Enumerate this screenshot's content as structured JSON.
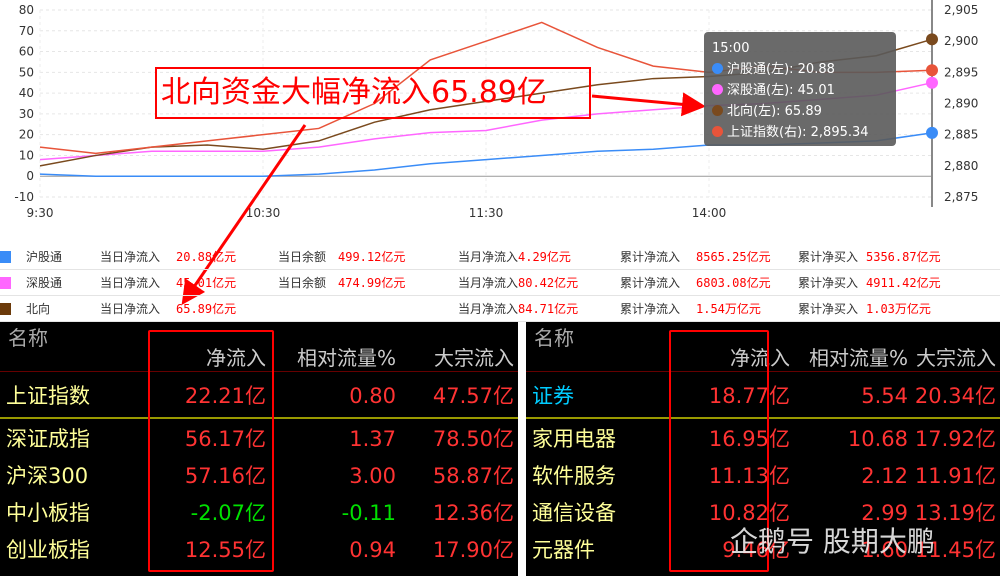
{
  "chart_data": {
    "type": "line",
    "x_ticks": [
      "9:30",
      "10:30",
      "11:30",
      "14:00"
    ],
    "y_left": {
      "range": [
        -10,
        80
      ],
      "ticks": [
        -10,
        0,
        10,
        20,
        30,
        40,
        50,
        60,
        70,
        80
      ]
    },
    "y_right": {
      "range": [
        2875,
        2905
      ],
      "ticks": [
        "2,875",
        "2,880",
        "2,885",
        "2,890",
        "2,895",
        "2,900",
        "2,905"
      ]
    },
    "times": [
      "9:30",
      "9:45",
      "10:00",
      "10:15",
      "10:30",
      "10:45",
      "11:00",
      "11:15",
      "11:30",
      "13:15",
      "13:30",
      "13:45",
      "14:00",
      "14:15",
      "14:30",
      "14:45",
      "15:00"
    ],
    "series": [
      {
        "name": "沪股通(左)",
        "axis": "left",
        "color": "#3a8cf7",
        "values": [
          1,
          0,
          0,
          0,
          0,
          1,
          3,
          6,
          8,
          10,
          12,
          13,
          15,
          15,
          16,
          17,
          20.88
        ]
      },
      {
        "name": "深股通(左)",
        "axis": "left",
        "color": "#ff66ff",
        "values": [
          8,
          10,
          12,
          12,
          12,
          14,
          18,
          21,
          22,
          27,
          30,
          32,
          34,
          35,
          37,
          39,
          45.01
        ]
      },
      {
        "name": "北向(左)",
        "axis": "left",
        "color": "#7a4a1e",
        "values": [
          5,
          10,
          14,
          15,
          13,
          17,
          26,
          32,
          36,
          40,
          44,
          47,
          48,
          50,
          55,
          58,
          65.89
        ]
      },
      {
        "name": "上证指数(右)",
        "axis": "right",
        "color": "#e8543a",
        "values": [
          2883,
          2882,
          2883,
          2884,
          2885,
          2886,
          2890,
          2897,
          2900,
          2903,
          2899,
          2896,
          2895,
          2896,
          2895,
          2895,
          2895.34
        ]
      }
    ]
  },
  "tooltip": {
    "time": "15:00",
    "items": [
      {
        "label": "沪股通(左): 20.88",
        "color": "#3a8cf7"
      },
      {
        "label": "深股通(左): 45.01",
        "color": "#ff66ff"
      },
      {
        "label": "北向(左): 65.89",
        "color": "#7a4a1e"
      },
      {
        "label": "上证指数(右): 2,895.34",
        "color": "#e8543a"
      }
    ]
  },
  "annotation": "北向资金大幅净流入65.89亿",
  "stats": [
    {
      "name": "沪股通",
      "color": "#3a8cf7",
      "c": [
        [
          "当日净流入",
          "20.88亿元"
        ],
        [
          "当日余额",
          "499.12亿元"
        ],
        [
          "当月净流入",
          "4.29亿元"
        ],
        [
          "累计净流入",
          "8565.25亿元"
        ],
        [
          "累计净买入",
          "5356.87亿元"
        ]
      ]
    },
    {
      "name": "深股通",
      "color": "#ff66ff",
      "c": [
        [
          "当日净流入",
          "45.01亿元"
        ],
        [
          "当日余额",
          "474.99亿元"
        ],
        [
          "当月净流入",
          "80.42亿元"
        ],
        [
          "累计净流入",
          "6803.08亿元"
        ],
        [
          "累计净买入",
          "4911.42亿元"
        ]
      ]
    },
    {
      "name": "北向",
      "color": "#6b3a0a",
      "c": [
        [
          "当日净流入",
          "65.89亿元"
        ],
        [
          "",
          ""
        ],
        [
          "当月净流入",
          "84.71亿元"
        ],
        [
          "累计净流入",
          "1.54万亿元"
        ],
        [
          "累计净买入",
          "1.03万亿元"
        ]
      ]
    }
  ],
  "left_table": {
    "name_header": "名称",
    "headers": [
      "净流入",
      "相对流量%",
      "大宗流入"
    ],
    "rows": [
      [
        "上证指数",
        "22.21亿",
        "0.80",
        "47.57亿"
      ],
      [
        "深证成指",
        "56.17亿",
        "1.37",
        "78.50亿"
      ],
      [
        "沪深300",
        "57.16亿",
        "3.00",
        "58.87亿"
      ],
      [
        "中小板指",
        "-2.07亿",
        "-0.11",
        "12.36亿"
      ],
      [
        "创业板指",
        "12.55亿",
        "0.94",
        "17.90亿"
      ]
    ]
  },
  "right_table": {
    "name_header": "名称",
    "headers": [
      "净流入",
      "相对流量%",
      "大宗流入"
    ],
    "rows": [
      [
        "证券",
        "18.77亿",
        "5.54",
        "20.34亿"
      ],
      [
        "家用电器",
        "16.95亿",
        "10.68",
        "17.92亿"
      ],
      [
        "软件服务",
        "11.13亿",
        "2.12",
        "11.91亿"
      ],
      [
        "通信设备",
        "10.82亿",
        "2.99",
        "13.19亿"
      ],
      [
        "元器件",
        "9.46亿",
        "1.60",
        "11.45亿"
      ]
    ]
  },
  "watermark": "企鹅号 股期大鹏"
}
